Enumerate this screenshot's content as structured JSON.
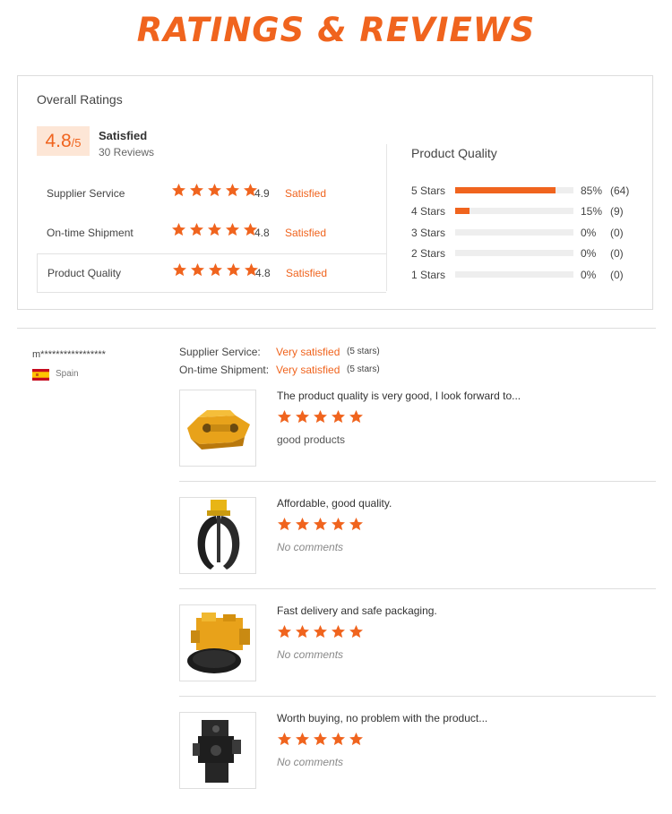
{
  "title": "RATINGS & REVIEWS",
  "overall": {
    "label": "Overall Ratings",
    "score": "4.8",
    "score_max": "/5",
    "word": "Satisfied",
    "reviews": "30 Reviews"
  },
  "dimensions": [
    {
      "name": "Supplier Service",
      "score": "4.9",
      "word": "Satisfied",
      "stars": 5
    },
    {
      "name": "On-time Shipment",
      "score": "4.8",
      "word": "Satisfied",
      "stars": 5
    },
    {
      "name": "Product Quality",
      "score": "4.8",
      "word": "Satisfied",
      "stars": 5
    }
  ],
  "product_quality": {
    "title": "Product Quality",
    "bars": [
      {
        "label": "5  Stars",
        "percent": "85%",
        "count": "(64)",
        "fraction": 0.85
      },
      {
        "label": "4  Stars",
        "percent": "15%",
        "count": "(9)",
        "fraction": 0.12
      },
      {
        "label": "3  Stars",
        "percent": "0%",
        "count": "(0)",
        "fraction": 0
      },
      {
        "label": "2  Stars",
        "percent": "0%",
        "count": "(0)",
        "fraction": 0
      },
      {
        "label": "1  Stars",
        "percent": "0%",
        "count": "(0)",
        "fraction": 0
      }
    ]
  },
  "reviewer": {
    "name": "m*****************",
    "country": "Spain",
    "flag_icon": "spain-flag-icon"
  },
  "review_meta": {
    "supplier_label": "Supplier Service:",
    "supplier_value": "Very satisfied",
    "supplier_stars": "(5 stars)",
    "shipment_label": "On-time Shipment:",
    "shipment_value": "Very satisfied",
    "shipment_stars": "(5 stars)"
  },
  "reviews": [
    {
      "text": "The product quality is very good, I look forward to...",
      "stars": 5,
      "comment": "good products",
      "has_comment": true,
      "image": "yellow-quick-coupler"
    },
    {
      "text": "Affordable, good quality.",
      "stars": 5,
      "comment": "No comments",
      "has_comment": false,
      "image": "grapple-attachment"
    },
    {
      "text": "Fast delivery and safe packaging.",
      "stars": 5,
      "comment": "No comments",
      "has_comment": false,
      "image": "yellow-hydraulic-pump"
    },
    {
      "text": "Worth buying, no problem with the product...",
      "stars": 5,
      "comment": "No comments",
      "has_comment": false,
      "image": "black-hydraulic-pump"
    }
  ],
  "colors": {
    "accent": "#f0641e",
    "badge_bg": "#fde6d6",
    "track": "#eeeeee"
  }
}
